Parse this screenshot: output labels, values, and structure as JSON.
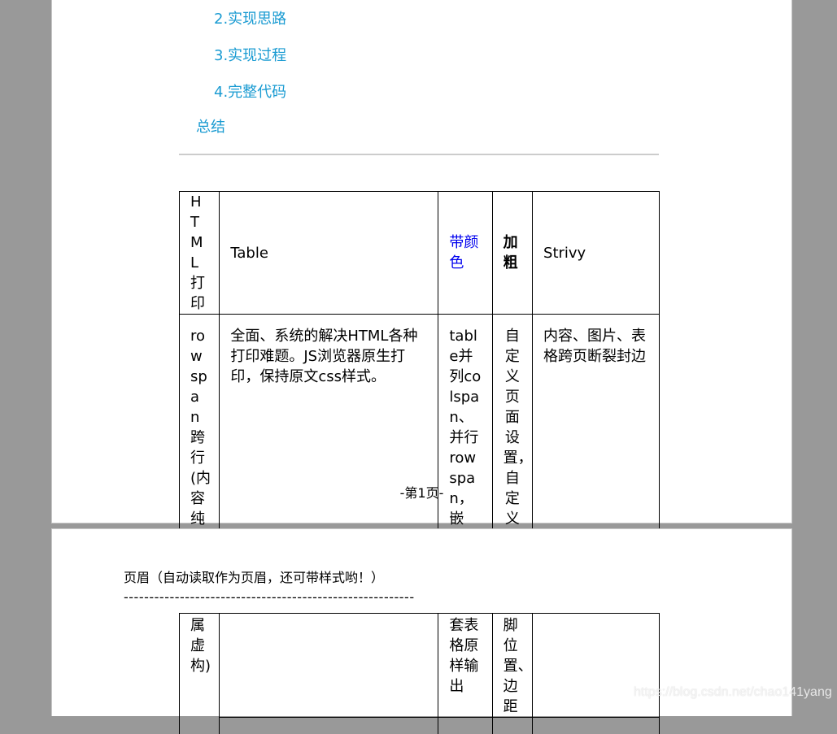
{
  "toc": {
    "items": [
      {
        "label": "2.实现思路",
        "level": 2
      },
      {
        "label": "3.实现过程",
        "level": 2
      },
      {
        "label": "4.完整代码",
        "level": 2
      },
      {
        "label": "总结",
        "level": 1
      }
    ],
    "link_color": "#1a9bd2"
  },
  "page1": {
    "table": {
      "header": [
        "HTML打印",
        "Table",
        "带颜色",
        "加粗",
        "Strivy"
      ],
      "row": [
        "rowspan跨行(内容纯",
        "全面、系统的解决HTML各种打印难题。JS浏览器原生打印，保持原文css样式。",
        "table并列colspan、并行rowspan，嵌",
        "自定义页面设置，自定义页眉页",
        "内容、图片、表格跨页断裂封边"
      ]
    },
    "page_number": "-第1页-"
  },
  "page2": {
    "header_text": "页眉（自动读取作为页眉，还可带样式哟！）",
    "header_rule": "---------------------------------------------------------",
    "table": {
      "row": [
        "属虚构)",
        "",
        "套表格原样输出",
        "脚位置、边距",
        ""
      ]
    }
  },
  "colors": {
    "background": "#999999",
    "page": "#ffffff",
    "colored_text": "#0000ee"
  },
  "watermark": "https://blog.csdn.net/chao141yang"
}
